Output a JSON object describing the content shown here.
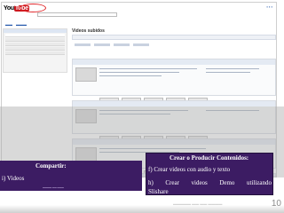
{
  "slide": {
    "overlay_heading": "Crear o Producir Contenidos:",
    "option_f": "f) Crear videos con audio y texto",
    "option_h_line1": "h)   Crear   videos   Demo   utilizando",
    "option_h_line2": "Slishare",
    "share_heading": "Compartir:",
    "share_item": "i) Videos",
    "page_number": "10"
  },
  "screenshot": {
    "main_title": "Videos subidos"
  },
  "colors": {
    "panel": "#3c1c63",
    "youtube_red": "#cc181e",
    "highlight_circle": "#e0262a"
  }
}
